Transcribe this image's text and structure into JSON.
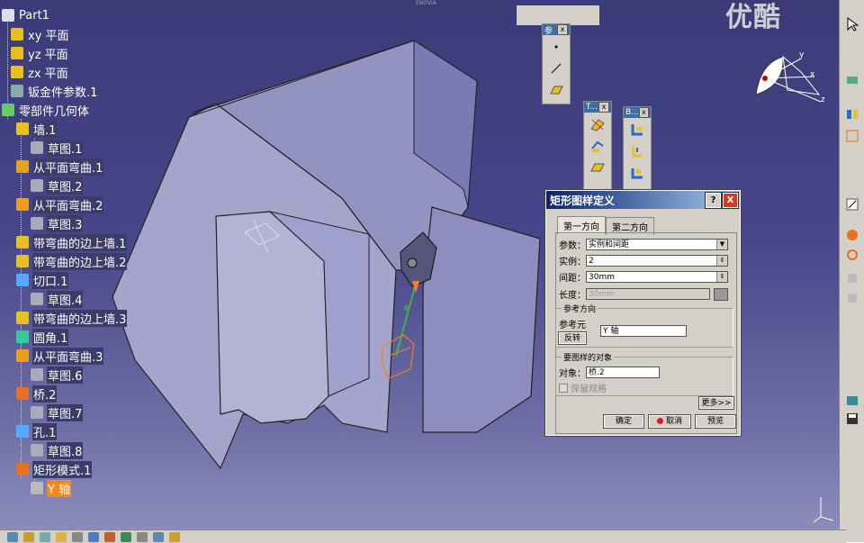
{
  "title_fragment": "ENOVIA",
  "watermark": "优酷",
  "tree": {
    "nodes": [
      {
        "label": "Part1",
        "icon": "gear-tree-icon"
      },
      {
        "label": "xy 平面",
        "icon": "plane-icon"
      },
      {
        "label": "yz 平面",
        "icon": "plane-icon"
      },
      {
        "label": "zx 平面",
        "icon": "plane-icon"
      },
      {
        "label": "钣金件参数.1",
        "icon": "sheetmetal-params-icon"
      },
      {
        "label": "零部件几何体",
        "icon": "part-body-icon"
      },
      {
        "label": "墙.1",
        "icon": "wall-icon"
      },
      {
        "label": "草图.1",
        "icon": "sketch-icon"
      },
      {
        "label": "从平面弯曲.1",
        "icon": "flange-icon"
      },
      {
        "label": "草图.2",
        "icon": "sketch-icon"
      },
      {
        "label": "从平面弯曲.2",
        "icon": "flange-icon"
      },
      {
        "label": "草图.3",
        "icon": "sketch-icon"
      },
      {
        "label": "带弯曲的边上墙.1",
        "icon": "wall-on-edge-icon"
      },
      {
        "label": "带弯曲的边上墙.2",
        "icon": "wall-on-edge-icon"
      },
      {
        "label": "切口.1",
        "icon": "cutout-icon"
      },
      {
        "label": "草图.4",
        "icon": "sketch-icon"
      },
      {
        "label": "带弯曲的边上墙.3",
        "icon": "wall-on-edge-icon"
      },
      {
        "label": "圆角.1",
        "icon": "corner-icon"
      },
      {
        "label": "从平面弯曲.3",
        "icon": "flange-icon"
      },
      {
        "label": "草图.6",
        "icon": "sketch-icon"
      },
      {
        "label": "桥.2",
        "icon": "bridge-icon"
      },
      {
        "label": "草图.7",
        "icon": "sketch-icon"
      },
      {
        "label": "孔.1",
        "icon": "hole-icon"
      },
      {
        "label": "草图.8",
        "icon": "sketch-icon"
      },
      {
        "label": "矩形模式.1",
        "icon": "pattern-icon"
      },
      {
        "label": "Y 轴",
        "icon": "axis-icon"
      }
    ]
  },
  "toolbars": {
    "ref_title": "参",
    "t2_title": "T...",
    "t3_title": "B..."
  },
  "dialog": {
    "title": "矩形图样定义",
    "help": "?",
    "close": "X",
    "tabs": [
      "第一方向",
      "第二方向"
    ],
    "params_label": "参数：",
    "params_value": "实例和间距",
    "instances_label": "实例：",
    "instances_value": "2",
    "spacing_label": "间距：",
    "spacing_value": "30mm",
    "length_label": "长度：",
    "length_value": "30mm",
    "ref_group": "参考方向",
    "ref_elem_label": "参考元素：",
    "ref_elem_value": "Y 轴",
    "reverse_button": "反转",
    "obj_group": "要图样的对象",
    "object_label": "对象：",
    "object_value": "桥.2",
    "keep_spec": "保留规格",
    "more_button": "更多>>",
    "ok_button": "确定",
    "cancel_button": "取消",
    "preview_button": "预览"
  },
  "compass_labels": {
    "x": "x",
    "y": "y",
    "z": "z"
  },
  "colors": {
    "selection": "#f7871e",
    "viewport_top": "#3b3b78",
    "dialog_title": "#0a246a"
  }
}
